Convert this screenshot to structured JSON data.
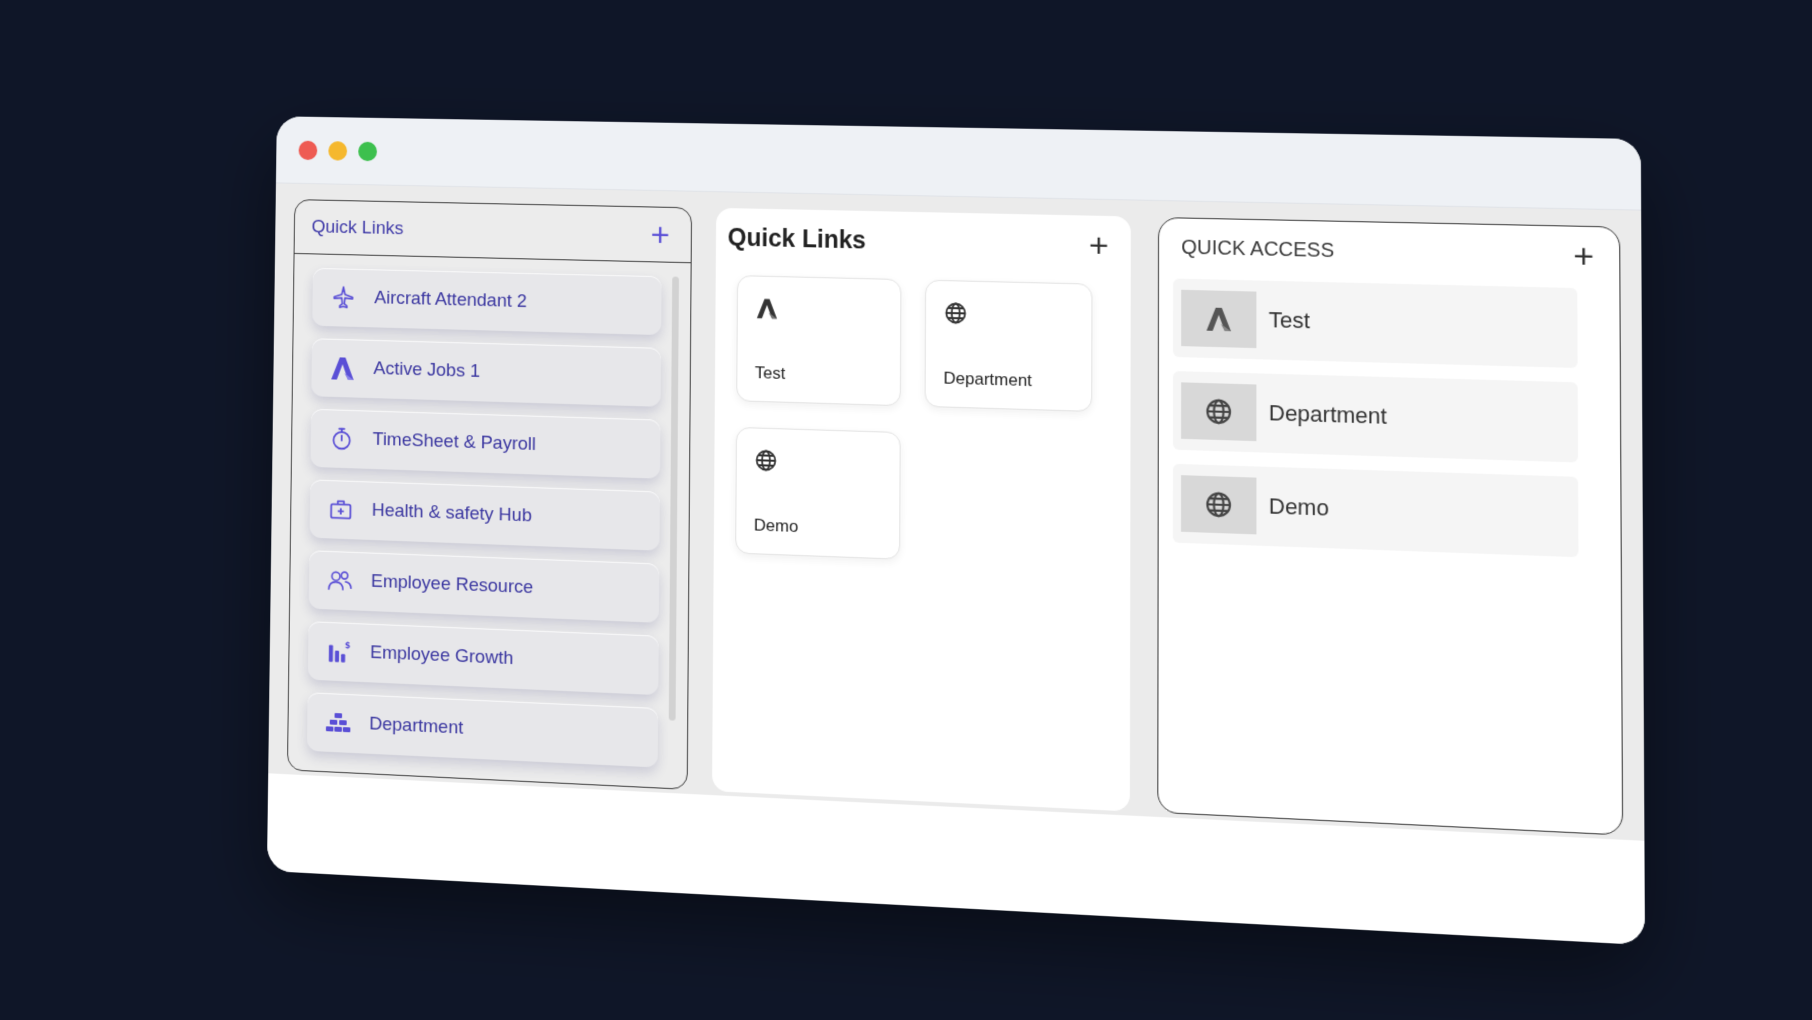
{
  "window": {
    "controls": [
      "close",
      "minimize",
      "maximize"
    ]
  },
  "panel_left": {
    "title": "Quick Links",
    "add_label": "+",
    "items": [
      {
        "label": "Aircraft Attendant 2",
        "icon": "airplane-icon"
      },
      {
        "label": "Active Jobs 1",
        "icon": "logo-a-icon"
      },
      {
        "label": "TimeSheet & Payroll",
        "icon": "stopwatch-icon"
      },
      {
        "label": "Health & safety Hub",
        "icon": "medical-kit-icon"
      },
      {
        "label": "Employee Resource",
        "icon": "people-icon"
      },
      {
        "label": "Employee Growth",
        "icon": "growth-chart-icon"
      },
      {
        "label": "Department",
        "icon": "department-icon"
      }
    ]
  },
  "panel_middle": {
    "title": "Quick Links",
    "add_label": "+",
    "tiles": [
      {
        "label": "Test",
        "icon": "logo-a-icon"
      },
      {
        "label": "Department",
        "icon": "globe-icon"
      },
      {
        "label": "Demo",
        "icon": "globe-icon"
      }
    ]
  },
  "panel_right": {
    "title": "QUICK ACCESS",
    "add_label": "+",
    "items": [
      {
        "label": "Test",
        "icon": "logo-a-icon"
      },
      {
        "label": "Department",
        "icon": "globe-icon"
      },
      {
        "label": "Demo",
        "icon": "globe-icon"
      }
    ]
  },
  "colors": {
    "background": "#0f1628",
    "accent_purple": "#5a4fd6",
    "link_text": "#3a36a0"
  }
}
